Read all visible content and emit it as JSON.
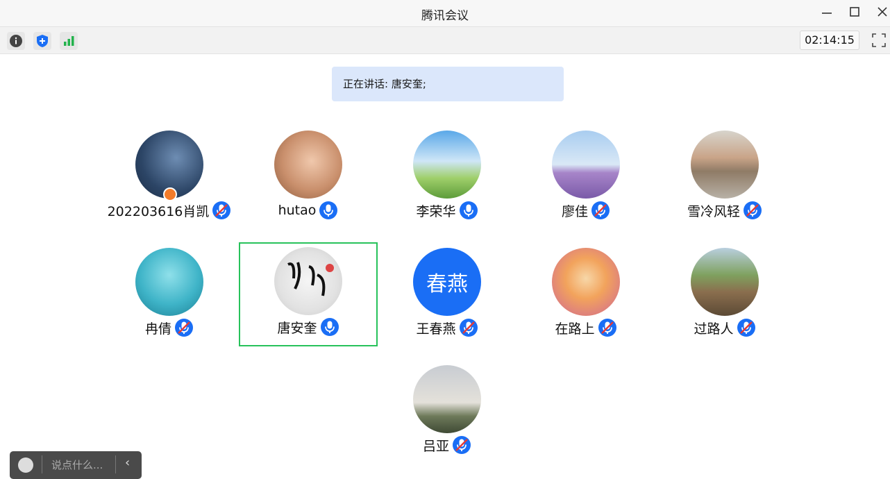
{
  "window": {
    "title": "腾讯会议"
  },
  "toolbar": {
    "timer": "02:14:15"
  },
  "banner": {
    "text": "正在讲话: 唐安奎;"
  },
  "participants": [
    {
      "name": "202203616肖凯",
      "mic": "muted",
      "host": true
    },
    {
      "name": "hutao",
      "mic": "on"
    },
    {
      "name": "李荣华",
      "mic": "on"
    },
    {
      "name": "廖佳",
      "mic": "muted"
    },
    {
      "name": "雪冷风轻",
      "mic": "muted"
    },
    {
      "name": "冉倩",
      "mic": "muted"
    },
    {
      "name": "唐安奎",
      "mic": "on",
      "selected": true
    },
    {
      "name": "王春燕",
      "mic": "muted",
      "avatar_text": "春燕"
    },
    {
      "name": "在路上",
      "mic": "muted"
    },
    {
      "name": "过路人",
      "mic": "muted"
    },
    {
      "name": "吕亚",
      "mic": "muted"
    }
  ],
  "chat": {
    "placeholder": "说点什么..."
  },
  "colors": {
    "accent": "#1a6ef5",
    "selected_border": "#27c25a",
    "banner_bg": "#dbe7fb",
    "signal": "#22b24c"
  }
}
